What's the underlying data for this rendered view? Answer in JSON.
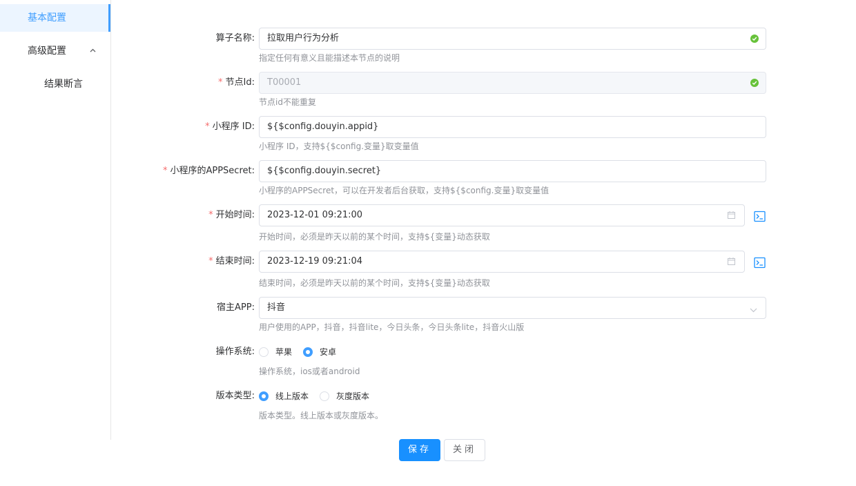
{
  "sidebar": {
    "items": [
      {
        "label": "基本配置"
      },
      {
        "label": "高级配置"
      },
      {
        "label": "结果断言"
      }
    ]
  },
  "form": {
    "operator_name": {
      "label": "算子名称:",
      "value": "拉取用户行为分析",
      "help": "指定任何有意义且能描述本节点的说明"
    },
    "node_id": {
      "label": "节点Id:",
      "value": "T00001",
      "help": "节点id不能重复"
    },
    "app_id": {
      "label": "小程序 ID:",
      "value": "${$config.douyin.appid}",
      "help": "小程序 ID，支持${$config.变量}取变量值"
    },
    "app_secret": {
      "label": "小程序的APPSecret:",
      "value": "${$config.douyin.secret}",
      "help": "小程序的APPSecret，可以在开发者后台获取，支持${$config.变量}取变量值"
    },
    "start_time": {
      "label": "开始时间:",
      "value": "2023-12-01 09:21:00",
      "help": "开始时间，必须是昨天以前的某个时间，支持${变量}动态获取"
    },
    "end_time": {
      "label": "结束时间:",
      "value": "2023-12-19 09:21:04",
      "help": "结束时间，必须是昨天以前的某个时间，支持${变量}动态获取"
    },
    "host_app": {
      "label": "宿主APP:",
      "value": "抖音",
      "help": "用户使用的APP，抖音，抖音lite，今日头条，今日头条lite，抖音火山版"
    },
    "os": {
      "label": "操作系统:",
      "options": [
        "苹果",
        "安卓"
      ],
      "selected": "安卓",
      "help": "操作系统，ios或者android"
    },
    "version_type": {
      "label": "版本类型:",
      "options": [
        "线上版本",
        "灰度版本"
      ],
      "selected": "线上版本",
      "help": "版本类型。线上版本或灰度版本。"
    }
  },
  "actions": {
    "save_label": "保存",
    "close_label": "关闭"
  },
  "colors": {
    "primary": "#1890ff",
    "success": "#67c23a",
    "required": "#f56c6c",
    "menu_active_bg": "#ecf5ff"
  }
}
